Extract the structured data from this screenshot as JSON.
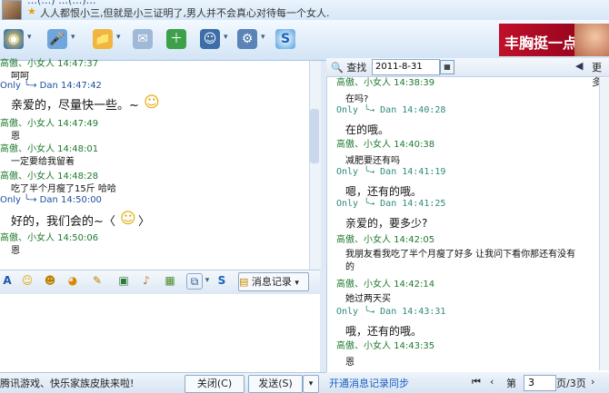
{
  "title": {
    "top_name_fragment": "…(…) …(…)…",
    "status": "人人都恨小三,但就是小三证明了,男人并不会真心对待每一个女人."
  },
  "ad": {
    "text": "丰胸挺一点"
  },
  "chat": {
    "messages": [
      {
        "header": "高傲、小女人   14:47:37",
        "body": "呵呵",
        "who": "her",
        "size": "s"
      },
      {
        "header": "Only ╰→ Dan   14:47:42",
        "body": "亲爱的，尽量快一些。~",
        "who": "me",
        "size": "l",
        "smiley": true
      },
      {
        "header": "高傲、小女人   14:47:49",
        "body": "恩",
        "who": "her",
        "size": "s"
      },
      {
        "header": "高傲、小女人   14:48:01",
        "body": "一定要给我留着",
        "who": "her",
        "size": "s"
      },
      {
        "header": "高傲、小女人   14:48:28",
        "body": "吃了半个月瘦了15斤    哈哈",
        "who": "her",
        "size": "s"
      },
      {
        "header": "Only ╰→ Dan   14:50:00",
        "body": "好的，我们会的~〈",
        "who": "me",
        "size": "l",
        "smiley": true,
        "tail": "〉"
      },
      {
        "header": "高傲、小女人   14:50:06",
        "body": "恩",
        "who": "her",
        "size": "s"
      }
    ]
  },
  "input_toolbar": {
    "history_label": "消息记录"
  },
  "bottom": {
    "promo": "腾讯游戏、快乐家族皮肤来啦!",
    "close_label": "关闭(C)",
    "send_label": "发送(S)"
  },
  "history": {
    "find_label": "查找",
    "date_value": "2011-8-31",
    "more_label": "更多",
    "entries": [
      {
        "header": "高傲、小女人   14:38:39",
        "body": "在吗?",
        "who": "her",
        "size": "s"
      },
      {
        "header": "Only ╰→ Dan  14:40:28",
        "body": "在的哦。",
        "who": "me",
        "size": "m"
      },
      {
        "header": "高傲、小女人   14:40:38",
        "body": "减肥要还有吗",
        "who": "her",
        "size": "s"
      },
      {
        "header": "Only ╰→ Dan  14:41:19",
        "body": "嗯，还有的哦。",
        "who": "me",
        "size": "m"
      },
      {
        "header": "Only ╰→ Dan  14:41:25",
        "body": "亲爱的，要多少?",
        "who": "me",
        "size": "m"
      },
      {
        "header": "高傲、小女人   14:42:05",
        "body": "我朋友看我吃了半个月瘦了好多 让我问下看你那还有没有的",
        "who": "her",
        "size": "s",
        "wrap": true
      },
      {
        "header": "高傲、小女人   14:42:14",
        "body": "她过两天买",
        "who": "her",
        "size": "s"
      },
      {
        "header": "Only ╰→ Dan  14:43:31",
        "body": "哦，还有的哦。",
        "who": "me",
        "size": "m"
      },
      {
        "header": "高傲、小女人   14:43:35",
        "body": "恩",
        "who": "her",
        "size": "s"
      }
    ],
    "footer": {
      "sync_label": "开通消息记录同步",
      "page_label": "第",
      "page_value": "3",
      "page_total": "页/3页"
    }
  },
  "colors": {
    "her_name": "#1f7a2d",
    "me_name": "#1b4f9a",
    "link": "#1a5ec1",
    "accent": "#8eaac8"
  }
}
